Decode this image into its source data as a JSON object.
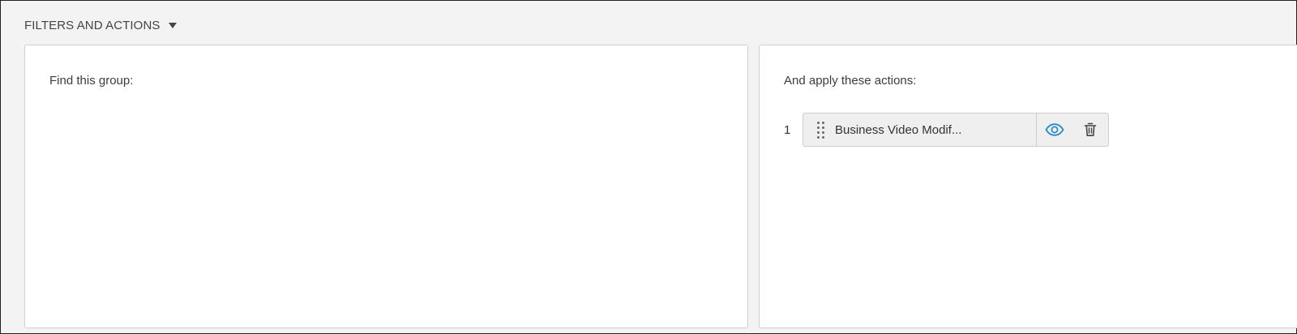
{
  "section": {
    "title": "FILTERS AND ACTIONS",
    "caret_icon": "caret-down-icon"
  },
  "filter_panel": {
    "title": "Find this group:"
  },
  "action_panel": {
    "title": "And apply these actions:",
    "actions": [
      {
        "index": "1",
        "label": "Business Video Modif...",
        "icons": [
          "drag-handle-icon",
          "eye-icon",
          "trash-icon"
        ]
      }
    ]
  },
  "colors": {
    "frame_bg": "#f3f3f3",
    "panel_bg": "#ffffff",
    "chip_bg": "#efefef",
    "eye_icon": "#2a8fc4",
    "border": "#cfcfcf"
  }
}
